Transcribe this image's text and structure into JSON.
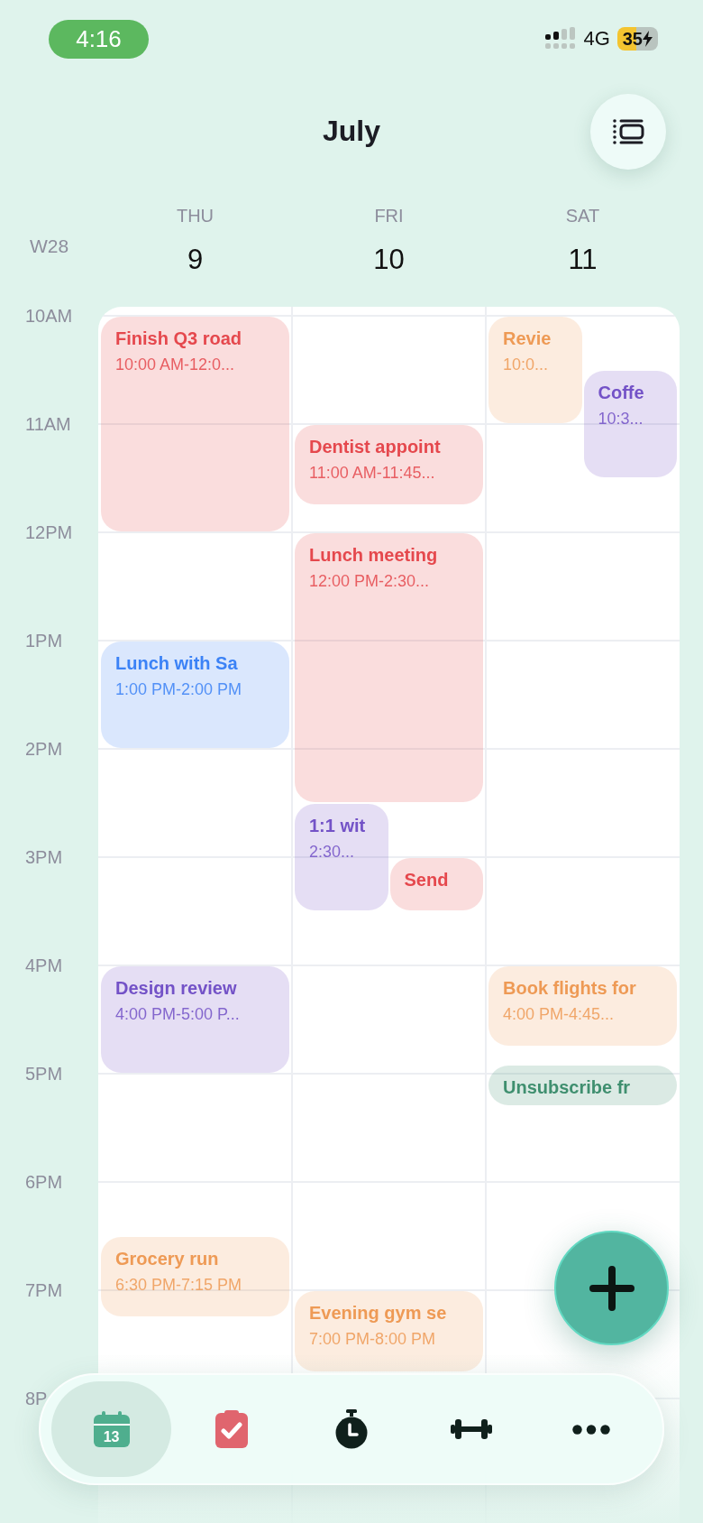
{
  "status_bar": {
    "time": "4:16",
    "network": "4G",
    "battery": "35"
  },
  "header": {
    "title": "July"
  },
  "week": "W28",
  "hours": [
    "10AM",
    "11AM",
    "12PM",
    "1PM",
    "2PM",
    "3PM",
    "4PM",
    "5PM",
    "6PM",
    "7PM",
    "8P"
  ],
  "days": [
    {
      "weekday": "THU",
      "date": "9",
      "events": [
        {
          "title": "Finish Q3 road",
          "time": "10:00 AM-12:0...",
          "color": "#e5484d"
        },
        {
          "title": "Lunch with Sa",
          "time": "1:00 PM-2:00 PM",
          "color": "#3b82f6"
        },
        {
          "title": "Design review",
          "time": "4:00 PM-5:00 P...",
          "color": "#7352c7"
        },
        {
          "title": "Grocery run",
          "time": "6:30 PM-7:15 PM",
          "color": "#ee9a55"
        }
      ]
    },
    {
      "weekday": "FRI",
      "date": "10",
      "events": [
        {
          "title": "Dentist appoint",
          "time": "11:00 AM-11:45...",
          "color": "#e5484d"
        },
        {
          "title": "Lunch meeting",
          "time": "12:00 PM-2:30...",
          "color": "#e5484d"
        },
        {
          "title": "1:1 wit",
          "time": "2:30...",
          "color": "#7352c7"
        },
        {
          "title": "Send",
          "color": "#e5484d"
        },
        {
          "title": "Evening gym se",
          "time": "7:00 PM-8:00 PM",
          "color": "#ee9a55"
        }
      ]
    },
    {
      "weekday": "SAT",
      "date": "11",
      "events": [
        {
          "title": "Revie",
          "time": "10:0...",
          "color": "#ee9a55"
        },
        {
          "title": "Coffe",
          "time": "10:3...",
          "color": "#7352c7"
        },
        {
          "title": "Book flights for",
          "time": "4:00 PM-4:45...",
          "color": "#ee9a55"
        },
        {
          "title": "Unsubscribe fr",
          "color": "#3f8f6f"
        }
      ]
    }
  ],
  "tab_bar": [
    {
      "kind": "calendar",
      "selected": true,
      "date": "13"
    },
    {
      "kind": "tasks",
      "selected": false
    },
    {
      "kind": "timer",
      "selected": false
    },
    {
      "kind": "workout",
      "selected": false
    },
    {
      "kind": "more",
      "selected": false
    }
  ]
}
